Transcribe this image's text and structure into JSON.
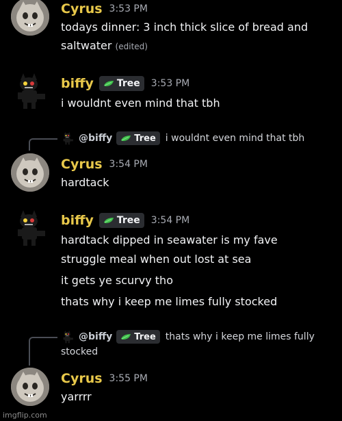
{
  "messages": [
    {
      "author": "Cyrus",
      "time": "3:53 PM",
      "lines": [
        "todays dinner: 3 inch thick slice of bread and",
        "saltwater"
      ],
      "edited": "(edited)"
    },
    {
      "author": "biffy",
      "tag": "Tree",
      "time": "3:53 PM",
      "lines": [
        "i wouldnt even mind that tbh"
      ]
    },
    {
      "reply": {
        "author": "@biffy",
        "tag": "Tree",
        "text": "i wouldnt even mind that tbh"
      },
      "author": "Cyrus",
      "time": "3:54 PM",
      "lines": [
        "hardtack"
      ]
    },
    {
      "author": "biffy",
      "tag": "Tree",
      "time": "3:54 PM",
      "lines": [
        "hardtack dipped in seawater is my fave",
        "struggle meal when out lost at sea",
        "it gets ye scurvy tho",
        "thats why i keep me limes fully stocked"
      ]
    },
    {
      "reply": {
        "author": "@biffy",
        "tag": "Tree",
        "text": "thats why i keep me limes fully",
        "text2": "stocked"
      },
      "author": "Cyrus",
      "time": "3:55 PM",
      "lines": [
        "yarrrr"
      ]
    }
  ],
  "watermark": "imgflip.com",
  "colors": {
    "background": "#000000",
    "username": "#e8c84a",
    "timestamp": "#a8abb3",
    "tag_bg": "#2b2d31",
    "leaf": "#3fbf4a"
  },
  "icons": {
    "leaf": "leaf-icon",
    "avatar_cyrus": "cyrus-avatar",
    "avatar_biffy": "biffy-avatar"
  }
}
